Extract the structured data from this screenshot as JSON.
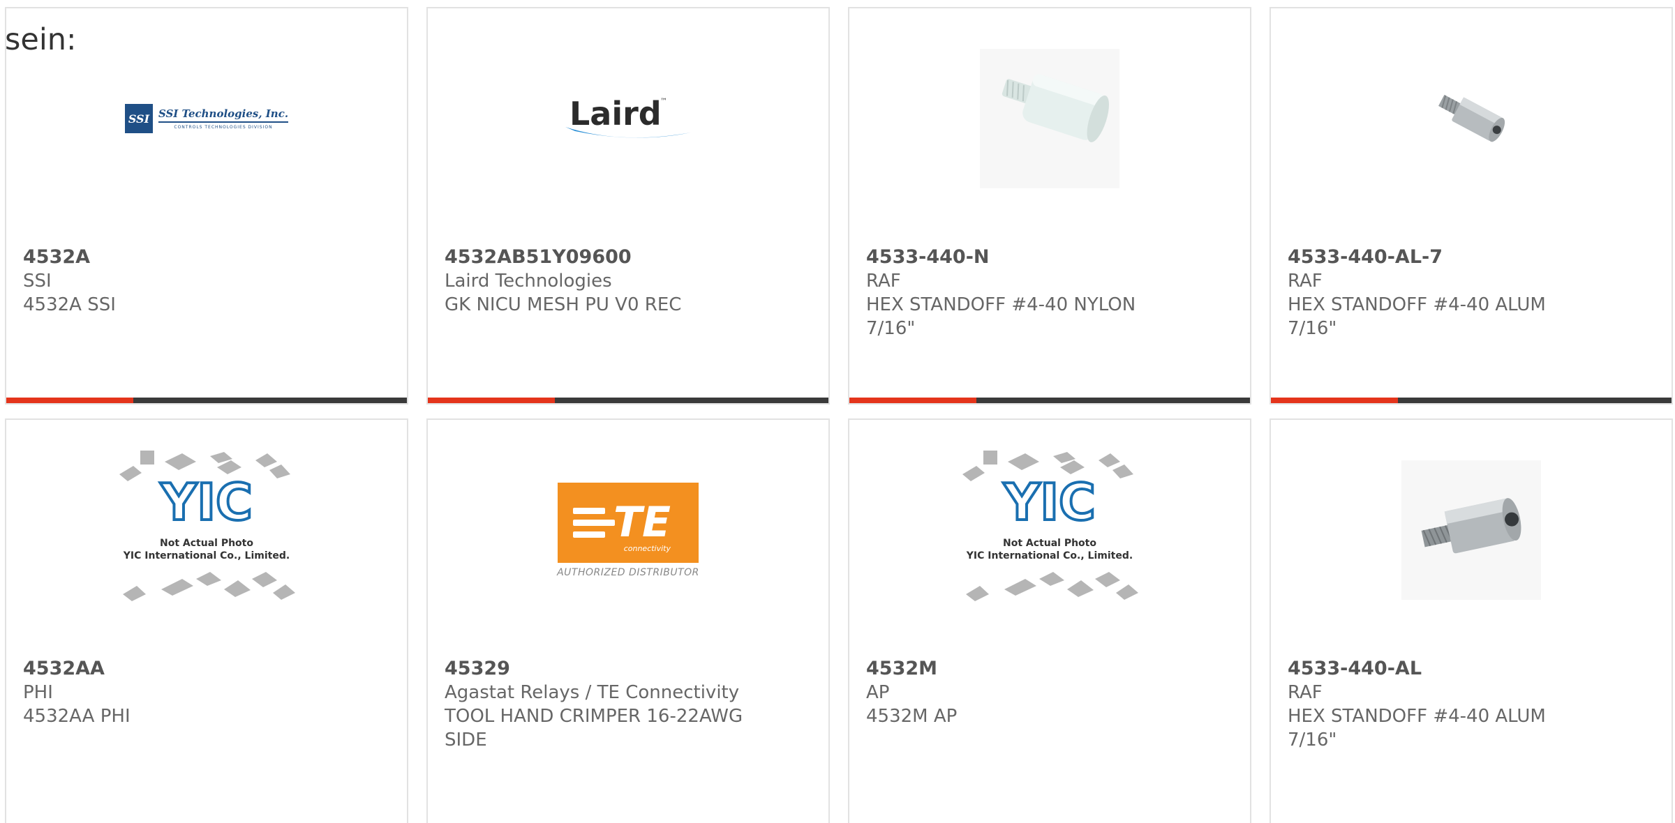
{
  "page": {
    "top_label": "sein:"
  },
  "colors": {
    "accent": "#e4341b",
    "bar": "#3a3a3a",
    "border": "#e2e2e2",
    "text": "#666666"
  },
  "products": [
    {
      "part_number": "4532A",
      "manufacturer": "SSI",
      "description": [
        "4532A SSI"
      ],
      "image": "ssi-technologies-logo",
      "logo": {
        "name": "SSI Technologies, Inc.",
        "box": "SSI",
        "sub": "CONTROLS TECHNOLOGIES DIVISION"
      }
    },
    {
      "part_number": "4532AB51Y09600",
      "manufacturer": "Laird Technologies",
      "description": [
        "GK NICU MESH PU V0 REC"
      ],
      "image": "laird-logo",
      "logo": {
        "name": "Laird",
        "tm": "™"
      }
    },
    {
      "part_number": "4533-440-N",
      "manufacturer": "RAF",
      "description": [
        "HEX STANDOFF #4-40 NYLON",
        "7/16\""
      ],
      "image": "nylon-standoff-photo"
    },
    {
      "part_number": "4533-440-AL-7",
      "manufacturer": "RAF",
      "description": [
        "HEX STANDOFF #4-40 ALUM",
        "7/16\""
      ],
      "image": "aluminum-standoff-photo"
    },
    {
      "part_number": "4532AA",
      "manufacturer": "PHI",
      "description": [
        "4532AA PHI"
      ],
      "image": "yic-placeholder",
      "logo": {
        "line1": "Not Actual Photo",
        "line2": "YIC International Co., Limited."
      }
    },
    {
      "part_number": "45329",
      "manufacturer": "Agastat Relays / TE Connectivity",
      "description": [
        "TOOL HAND CRIMPER 16-22AWG",
        "SIDE"
      ],
      "image": "te-connectivity-logo",
      "logo": {
        "word": "TE",
        "sub": "connectivity",
        "auth": "AUTHORIZED DISTRIBUTOR"
      }
    },
    {
      "part_number": "4532M",
      "manufacturer": "AP",
      "description": [
        "4532M AP"
      ],
      "image": "yic-placeholder",
      "logo": {
        "line1": "Not Actual Photo",
        "line2": "YIC International Co., Limited."
      }
    },
    {
      "part_number": "4533-440-AL",
      "manufacturer": "RAF",
      "description": [
        "HEX STANDOFF #4-40 ALUM",
        "7/16\""
      ],
      "image": "aluminum-standoff-photo"
    }
  ]
}
